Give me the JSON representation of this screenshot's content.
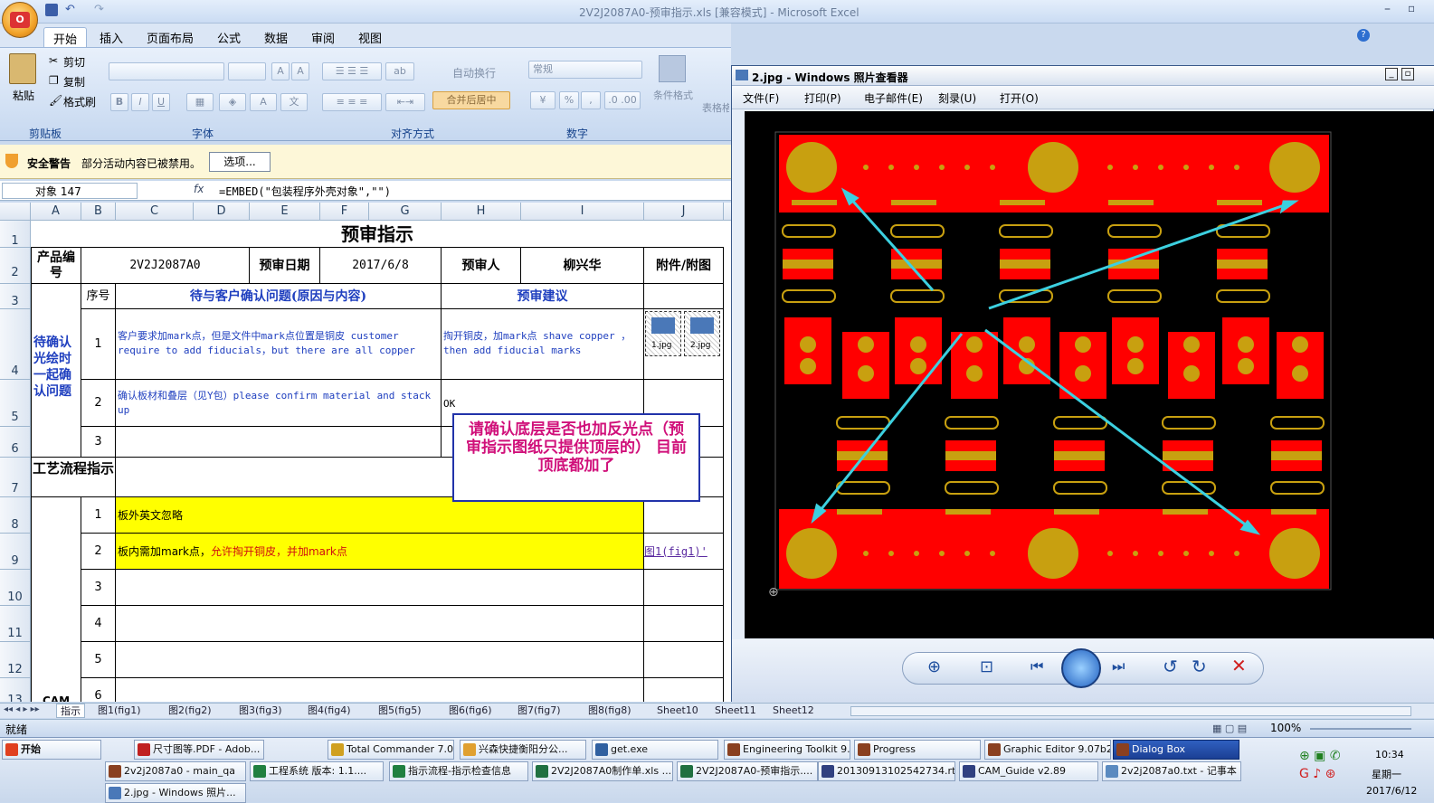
{
  "window_title": "2V2J2087A0-预审指示.xls  [兼容模式] - Microsoft Excel",
  "ribbon": {
    "tabs": [
      "开始",
      "插入",
      "页面布局",
      "公式",
      "数据",
      "审阅",
      "视图"
    ],
    "clipboard": {
      "paste": "粘贴",
      "cut": "剪切",
      "copy": "复制",
      "format_painter": "格式刷",
      "label": "剪贴板"
    },
    "font_label": "字体",
    "align": {
      "wrap": "自动换行",
      "merge": "合并后居中",
      "label": "对齐方式"
    },
    "number": {
      "format": "常规",
      "label": "数字"
    },
    "styles": {
      "cond_format": "条件格式",
      "table_fmt": "表格格"
    }
  },
  "security": {
    "title": "安全警告",
    "message": "部分活动内容已被禁用。",
    "options_button": "选项..."
  },
  "formula_bar": {
    "name_box": "对象 147",
    "fx": "fx",
    "formula": "=EMBED(\"包装程序外壳对象\",\"\")"
  },
  "columns": [
    "A",
    "B",
    "C",
    "D",
    "E",
    "F",
    "G",
    "H",
    "I",
    "J"
  ],
  "rows": [
    "1",
    "2",
    "3",
    "4",
    "5",
    "6",
    "7",
    "8",
    "9",
    "10",
    "11",
    "12",
    "13"
  ],
  "sheet": {
    "title": "预审指示",
    "product_label": "产品编号",
    "product_no": "2V2J2087A0",
    "date_label": "预审日期",
    "date": "2017/6/8",
    "reviewer_label": "预审人",
    "reviewer": "柳兴华",
    "attach_label": "附件/附图",
    "seq_label": "序号",
    "issue_header": "待与客户确认问题(原因与内容)",
    "suggest_header": "预审建议",
    "pending_label": "待确认光绘时一起确认问题",
    "issue1": "客户要求加mark点，但是文件中mark点位置是铜皮 customer require to add fiducials，but there are all copper",
    "suggest1": "掏开铜皮，加mark点 shave copper ，then add fiducial marks",
    "attach1": "1.jpg",
    "attach2": "2.jpg",
    "issue2": "确认板材和叠层（见Y包）please confirm material and stack up",
    "suggest2": "OK",
    "seq1": "1",
    "seq2": "2",
    "seq3": "3",
    "process_label": "工艺流程指示",
    "p1": "板外英文忽略",
    "p2_a": "板内需加mark点，",
    "p2_b": "允许掏开铜皮，并加mark点",
    "p2_link": "图1(fig1)'",
    "pseq": [
      "1",
      "2",
      "3",
      "4",
      "5",
      "6"
    ],
    "cam_label": "CAM",
    "comment": "请确认底层是否也加反光点（预审指示图纸只提供顶层的） 目前顶底都加了"
  },
  "sheet_tabs": [
    "指示",
    "图1(fig1)",
    "图2(fig2)",
    "图3(fig3)",
    "图4(fig4)",
    "图5(fig5)",
    "图6(fig6)",
    "图7(fig7)",
    "图8(fig8)",
    "Sheet10",
    "Sheet11",
    "Sheet12"
  ],
  "status": {
    "ready": "就绪",
    "zoom": "100%"
  },
  "viewer": {
    "title": "2.jpg - Windows 照片查看器",
    "menu": [
      "文件(F)",
      "打印(P)",
      "电子邮件(E)",
      "刻录(U)",
      "打开(O)"
    ]
  },
  "taskbar": {
    "start": "开始",
    "row1": [
      "尺寸图等.PDF - Adob...",
      "Total Commander 7.0...",
      "兴森快捷衡阳分公...",
      "get.exe",
      "Engineering Toolkit 9....",
      "Progress",
      "Graphic Editor 9.07b2...",
      "Dialog Box"
    ],
    "row2": [
      "2v2j2087a0 - main_qa",
      "工程系统  版本: 1.1....",
      "指示流程-指示检查信息",
      "2V2J2087A0制作单.xls ...",
      "2V2J2087A0-预审指示....",
      "20130913102542734.rt...",
      "CAM_Guide v2.89",
      "2v2j2087a0.txt - 记事本"
    ],
    "row3": [
      "2.jpg - Windows 照片..."
    ],
    "time": "10:34",
    "weekday": "星期一",
    "date": "2017/6/12"
  },
  "colors": {
    "pcb_red": "#ff0000",
    "pad_gold": "#c8a010",
    "arrow": "#3cd0e0",
    "highlight": "#ffff00",
    "comment_border": "#2233aa",
    "comment_text": "#d0107a"
  }
}
